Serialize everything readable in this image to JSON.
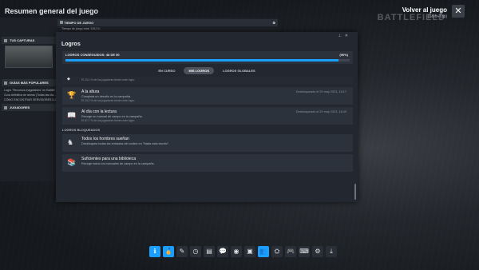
{
  "overlay": {
    "title": "Resumen general del juego",
    "back_main": "Volver al juego",
    "back_sub": "(Shift+Tab)",
    "bg_logo": "BATTLEFIELD",
    "close": "✕"
  },
  "left": {
    "playtime_header": "TIEMPO DE JUEGO",
    "playtime_total": "Tiempo de juego total: 126,3 h",
    "playtime_recent": "Últimas 2 semanas: 26 min",
    "captures_header": "TUS CAPTURAS",
    "guides_header": "GUÍAS MÁS POPULARES",
    "guides": [
      "Logro \"Recursos inagotables\" en Battlef...",
      "Guía definitiva de armas (Todas las cla...",
      "CÓMO ENCONTRAR SERVIDORES LLEN..."
    ],
    "players_header": "JUGADORES"
  },
  "achievements": {
    "title": "Logros",
    "progress_label": "LOGROS CONSEGUIDOS: 48 DE 50",
    "progress_pct": "(96%)",
    "progress_value": 0.96,
    "tabs": [
      "EN CURSO",
      "MIS LOGROS",
      "LOGROS GLOBALES"
    ],
    "active_tab": 1,
    "first_row_stat": "El 24,1 % de los jugadores tienen este logro",
    "unlocked": [
      {
        "title": "A la altura",
        "desc": "Completa un desafío en la campaña.",
        "stat": "El 24,0 % de los jugadores tienen este logro",
        "date": "Desbloqueado el 29 may 2023, 15:17"
      },
      {
        "title": "Al día con la lectura",
        "desc": "Recoge un manual de campo en la campaña.",
        "stat": "El 67,7 % de los jugadores tienen este logro",
        "date": "Desbloqueado el 29 may 2023, 16:49"
      }
    ],
    "locked_label": "LOGROS BLOQUEADOS",
    "locked": [
      {
        "title": "Todos los hombres sueñan",
        "desc": "Desbloquea todas las entradas del códice en \"Nada está escrito\"."
      },
      {
        "title": "Suficientes para una biblioteca",
        "desc": "Recoge todos los manuales de campo en la campaña."
      }
    ]
  },
  "dock": [
    "info",
    "achievements",
    "edit",
    "clock",
    "doc",
    "chat",
    "globe",
    "film",
    "friends",
    "controller",
    "gamepad",
    "keyboard",
    "gear",
    "download"
  ],
  "colors": {
    "accent": "#1a9fff"
  }
}
